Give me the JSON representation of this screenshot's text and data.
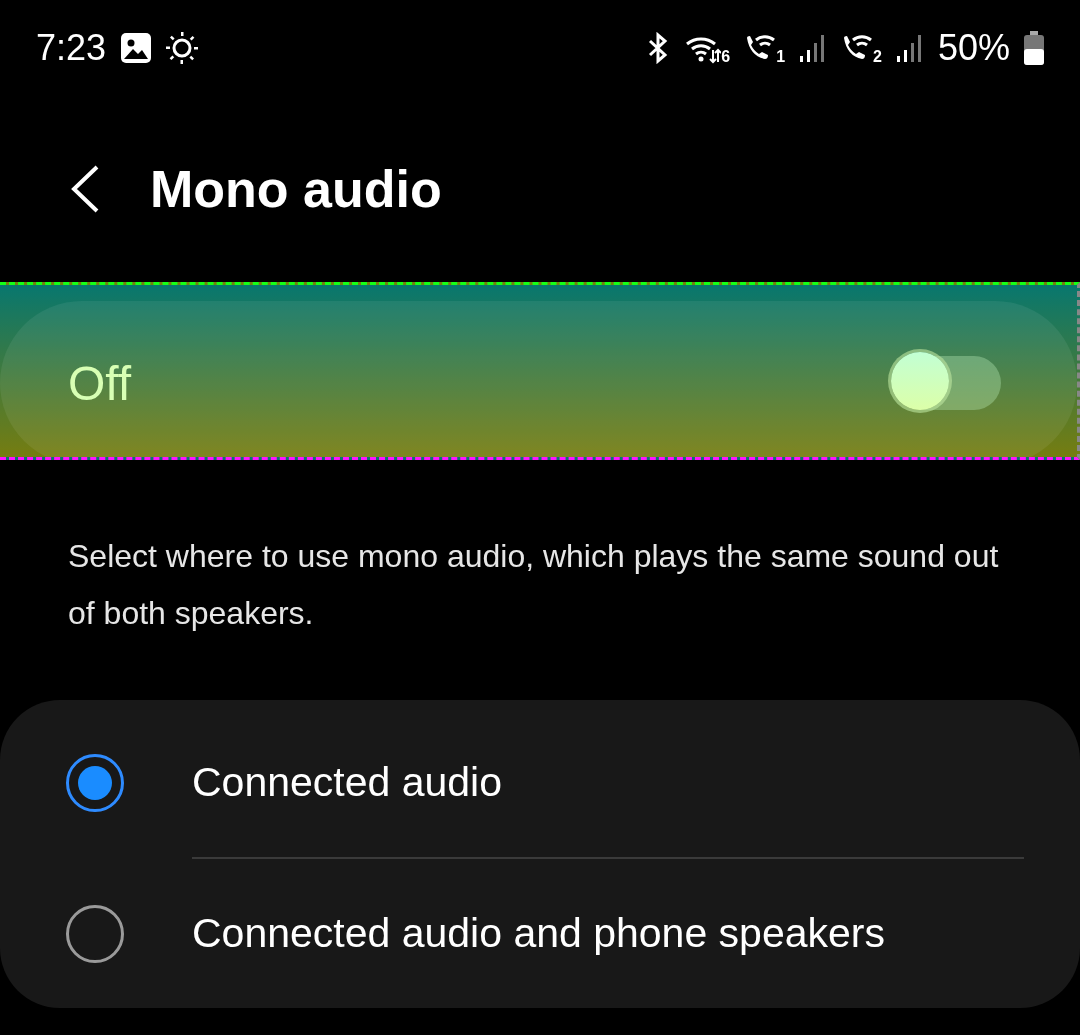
{
  "status_bar": {
    "time": "7:23",
    "wifi_badge": "6",
    "sim_badges": [
      "1",
      "2"
    ],
    "battery": "50%"
  },
  "header": {
    "title": "Mono audio"
  },
  "master_switch": {
    "label": "Off",
    "on": false
  },
  "description": "Select where to use mono audio, which plays the same sound out of both speakers.",
  "options": [
    {
      "label": "Connected audio",
      "selected": true
    },
    {
      "label": "Connected audio and phone speakers",
      "selected": false
    }
  ]
}
